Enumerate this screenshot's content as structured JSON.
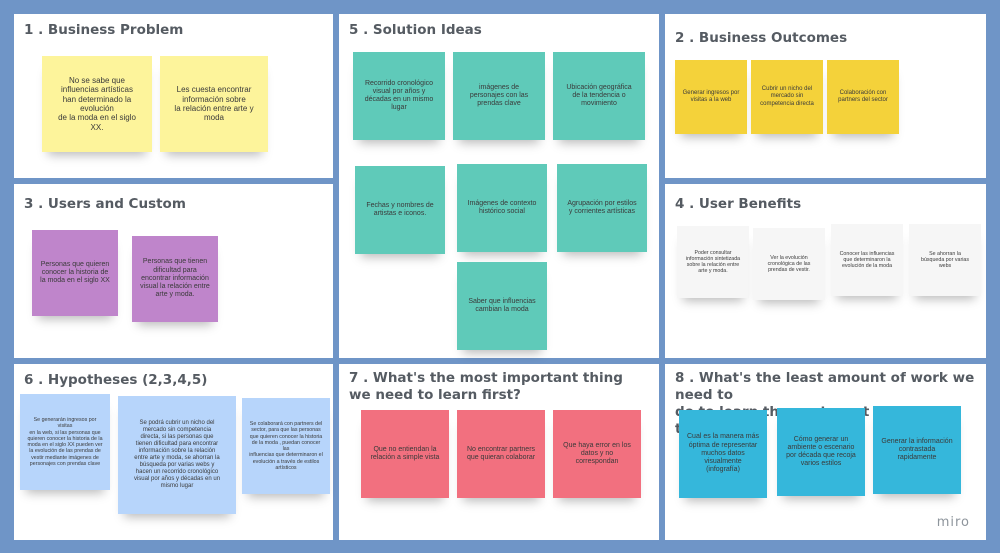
{
  "panels": {
    "business_problem": {
      "title": "1 . Business Problem",
      "notes": [
        "No se sabe que\ninfluencias artísticas\nhan determinado la\nevolución\nde la  moda en el siglo\nXX.",
        "Les cuesta encontrar\ninformación sobre\nla relación entre arte y\nmoda"
      ]
    },
    "solution_ideas": {
      "title": "5 . Solution Ideas",
      "notes": [
        "Recorrido cronológico\nvisual por años y\ndécadas en un mismo\nlugar",
        "imágenes de\npersonajes con las\nprendas clave",
        "Ubicación geográfica\nde la tendencia o\nmovimiento",
        "Fechas y nombres de\nartistas e iconos.",
        "Imágenes de contexto\nhistórico social",
        "Agrupación por estilos\ny corrientes artísticas",
        "Saber que influencias\ncambian la moda"
      ]
    },
    "business_outcomes": {
      "title": "2 . Business Outcomes",
      "notes": [
        "Generar ingresos por\nvisitas a la web",
        "Cubrir un nicho del\nmercado sin\ncompetencia directa",
        "Colaboración con\npartners del sector"
      ]
    },
    "users": {
      "title": "3 . Users and Custom",
      "notes": [
        "Personas que quieren\nconocer la historia de\nla moda en el siglo XX",
        "Personas que tienen\ndificultad para\nencontrar información\nvisual la relación entre\narte y moda."
      ]
    },
    "user_benefits": {
      "title": "4 . User Benefits",
      "notes": [
        "Poder consultar\ninformación sintetizada\nsobre la relación entre\narte y moda.",
        "Ver la evolución\ncronológica de las\nprendas de vestir.",
        "Conocer las influencias\nque determinaron la\nevolución de la moda",
        "Se ahorran la\nbúsqueda por varias\nwebs"
      ]
    },
    "hypotheses": {
      "title": "6 . Hypotheses (2,3,4,5)",
      "notes": [
        "Se generarán ingresos por visitas\nen la web, si las personas que\nquieren conocer la historia de la\nmoda en el siglo XX pueden ver\nla evolución de las prendas de\nvestir mediante imágenes de\npersonajes con prendas clave",
        "Se podrá cubrir un nicho del\nmercado sin competencia\ndirecta, si las personas que\ntienen dificultad para encontrar\ninformación sobre la relación\nentre arte y moda, se ahorran la\nbúsqueda por varias webs  y\nhacen un recorrido cronológico\nvisual por años y décadas en un\nmismo lugar",
        "Se colaborará con partners del\nsector, para que las personas\nque quieren conocer la historia\nde la moda , puedan conocer las\ninfluencias que determinaron el\nevolución a través de estilos\nartísticos"
      ]
    },
    "learn_first": {
      "title": "7 . What's the most important thing\nwe need to learn first?",
      "notes": [
        "Que no entiendan la\nrelación a simple vista",
        "No encontrar partners\nque quieran colaborar",
        "Que haya error en los\ndatos y no\ncorrespondan"
      ]
    },
    "least_work": {
      "title": "8 . What's the least amount of work we need to\ndo to learn the next most important thing?",
      "notes": [
        "Cual es la manera más\nóptima de representar\nmuchos datos\nvisualmente\n(infografía)",
        "Cómo generar un\nambiente o escenario\npor década que recoja\nvarios estilos",
        "Generar la información\ncontrastada\nrapidamente"
      ]
    }
  },
  "logo": "miro",
  "colors": {
    "background": "#6f95c7",
    "yellow": "#fdf49b",
    "gold": "#f4d23a",
    "purple": "#bf85cb",
    "teal": "#5fcab9",
    "light_blue": "#b7d5fb",
    "pink": "#f2707f",
    "cyan": "#35b7db"
  }
}
